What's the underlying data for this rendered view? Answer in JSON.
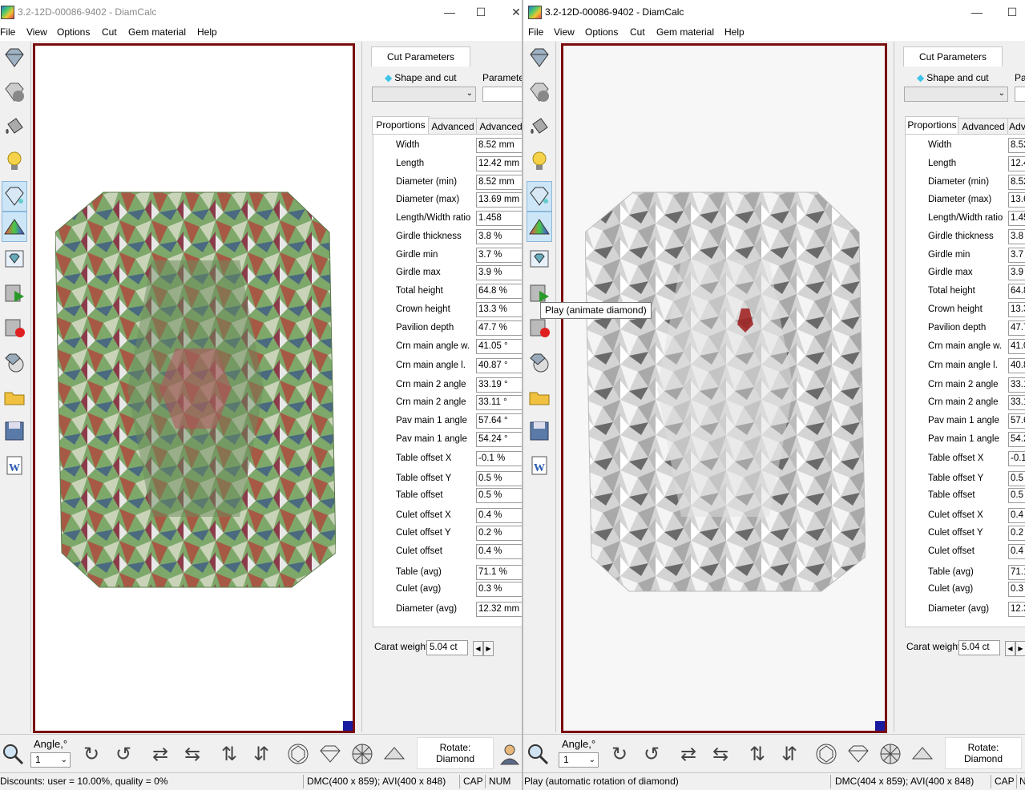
{
  "windows": {
    "left": {
      "title": "3.2-12D-00086-9402 - DiamCalc",
      "menu": [
        "File",
        "View",
        "Options",
        "Cut",
        "Gem material",
        "Help"
      ],
      "cut_parameters_tab": "Cut Parameters",
      "shape_and_cut_label": "Shape and cut",
      "parameter_label": "Parameter",
      "tabs": [
        "Proportions",
        "Advanced",
        "Advanced"
      ],
      "proportions": [
        {
          "label": "Width",
          "value": "8.52 mm"
        },
        {
          "label": "Length",
          "value": "12.42 mm"
        },
        {
          "label": "Diameter (min)",
          "value": "8.52 mm"
        },
        {
          "label": "Diameter (max)",
          "value": "13.69 mm"
        },
        {
          "label": "Length/Width ratio",
          "value": "1.458"
        },
        {
          "label": "Girdle thickness",
          "value": "3.8 %"
        },
        {
          "label": "Girdle min",
          "value": "3.7 %"
        },
        {
          "label": "Girdle max",
          "value": "3.9 %"
        },
        {
          "label": "Total height",
          "value": "64.8 %"
        },
        {
          "label": "Crown height",
          "value": "13.3 %"
        },
        {
          "label": "Pavilion depth",
          "value": "47.7 %"
        },
        {
          "label": "Crn main angle w.",
          "value": "41.05 °"
        },
        {
          "label": "Crn main angle l.",
          "value": "40.87 °"
        },
        {
          "label": "Crn main 2 angle",
          "value": "33.19 °"
        },
        {
          "label": "Crn main 2 angle",
          "value": "33.11 °"
        },
        {
          "label": "Pav main 1 angle",
          "value": "57.64 °"
        },
        {
          "label": "Pav main 1 angle",
          "value": "54.24 °"
        },
        {
          "label": "Table offset X",
          "value": "-0.1 %"
        },
        {
          "label": "Table offset Y",
          "value": "0.5 %"
        },
        {
          "label": "Table offset",
          "value": "0.5 %"
        },
        {
          "label": "Culet offset X",
          "value": "0.4 %"
        },
        {
          "label": "Culet offset Y",
          "value": "0.2 %"
        },
        {
          "label": "Culet offset",
          "value": "0.4 %"
        },
        {
          "label": "Table (avg)",
          "value": "71.1 %"
        },
        {
          "label": "Culet (avg)",
          "value": "0.3 %"
        },
        {
          "label": "Diameter (avg)",
          "value": "12.32 mm"
        }
      ],
      "carat_label": "Carat weight",
      "carat_value": "5.04 ct",
      "angle_label": "Angle,°",
      "angle_value": "1",
      "rotate_label": "Rotate:",
      "rotate_value": "Diamond",
      "status": {
        "message": "Discounts: user = 10.00%, quality = 0%",
        "size": "DMC(400 x 859); AVI(400 x 848)",
        "cap": "CAP",
        "num": "NUM"
      }
    },
    "right": {
      "title": "3.2-12D-00086-9402 - DiamCalc",
      "menu": [
        "File",
        "View",
        "Options",
        "Cut",
        "Gem material",
        "Help"
      ],
      "cut_parameters_tab": "Cut Parameters",
      "shape_and_cut_label": "Shape and cut",
      "parameter_label": "Pa",
      "tabs": [
        "Proportions",
        "Advanced",
        "Adv"
      ],
      "proportions": [
        {
          "label": "Width",
          "value": "8.52"
        },
        {
          "label": "Length",
          "value": "12.4"
        },
        {
          "label": "Diameter (min)",
          "value": "8.52"
        },
        {
          "label": "Diameter (max)",
          "value": "13.6"
        },
        {
          "label": "Length/Width ratio",
          "value": "1.45"
        },
        {
          "label": "Girdle thickness",
          "value": "3.8"
        },
        {
          "label": "Girdle min",
          "value": "3.7"
        },
        {
          "label": "Girdle max",
          "value": "3.9"
        },
        {
          "label": "Total height",
          "value": "64.8"
        },
        {
          "label": "Crown height",
          "value": "13.3"
        },
        {
          "label": "Pavilion depth",
          "value": "47.7"
        },
        {
          "label": "Crn main angle w.",
          "value": "41.0"
        },
        {
          "label": "Crn main angle l.",
          "value": "40.8"
        },
        {
          "label": "Crn main 2 angle",
          "value": "33.1"
        },
        {
          "label": "Crn main 2 angle",
          "value": "33.1"
        },
        {
          "label": "Pav main 1 angle",
          "value": "57.6"
        },
        {
          "label": "Pav main 1 angle",
          "value": "54.2"
        },
        {
          "label": "Table offset X",
          "value": "-0.1"
        },
        {
          "label": "Table offset Y",
          "value": "0.5"
        },
        {
          "label": "Table offset",
          "value": "0.5"
        },
        {
          "label": "Culet offset X",
          "value": "0.4"
        },
        {
          "label": "Culet offset Y",
          "value": "0.2"
        },
        {
          "label": "Culet offset",
          "value": "0.4"
        },
        {
          "label": "Table (avg)",
          "value": "71.1"
        },
        {
          "label": "Culet (avg)",
          "value": "0.3"
        },
        {
          "label": "Diameter (avg)",
          "value": "12.3"
        }
      ],
      "carat_label": "Carat weight",
      "carat_value": "5.04 ct",
      "angle_label": "Angle,°",
      "angle_value": "1",
      "rotate_label": "Rotate:",
      "rotate_value": "Diamond",
      "status": {
        "message": "Play (automatic rotation of diamond)",
        "size": "DMC(404 x 859); AVI(400 x 848)",
        "cap": "CAP",
        "num": "N"
      }
    }
  },
  "tooltip": "Play (animate diamond)",
  "colors": {
    "viewport_border": "#7a0c0c",
    "corner_marker": "#1a1aa0",
    "active_tool": "#cde6f7"
  },
  "icons": {
    "toolbar": [
      "diamond-view-icon",
      "diamond-gray-icon",
      "paint-bucket-icon",
      "light-bulb-icon",
      "sparkle-diamond-icon",
      "spectrum-icon",
      "diamond-card-icon",
      "play-video-icon",
      "record-video-icon",
      "film-reel-icon",
      "open-folder-icon",
      "save-icon",
      "word-export-icon"
    ],
    "bottom": [
      "zoom-icon",
      "rotate-cw-icon",
      "rotate-ccw-icon",
      "flip-horizontal-icon",
      "flip-horizontal-reverse-icon",
      "flip-vertical-icon",
      "flip-vertical-reverse-icon",
      "top-view-icon",
      "side-view-icon",
      "bottom-view-icon",
      "profile-view-icon"
    ]
  }
}
